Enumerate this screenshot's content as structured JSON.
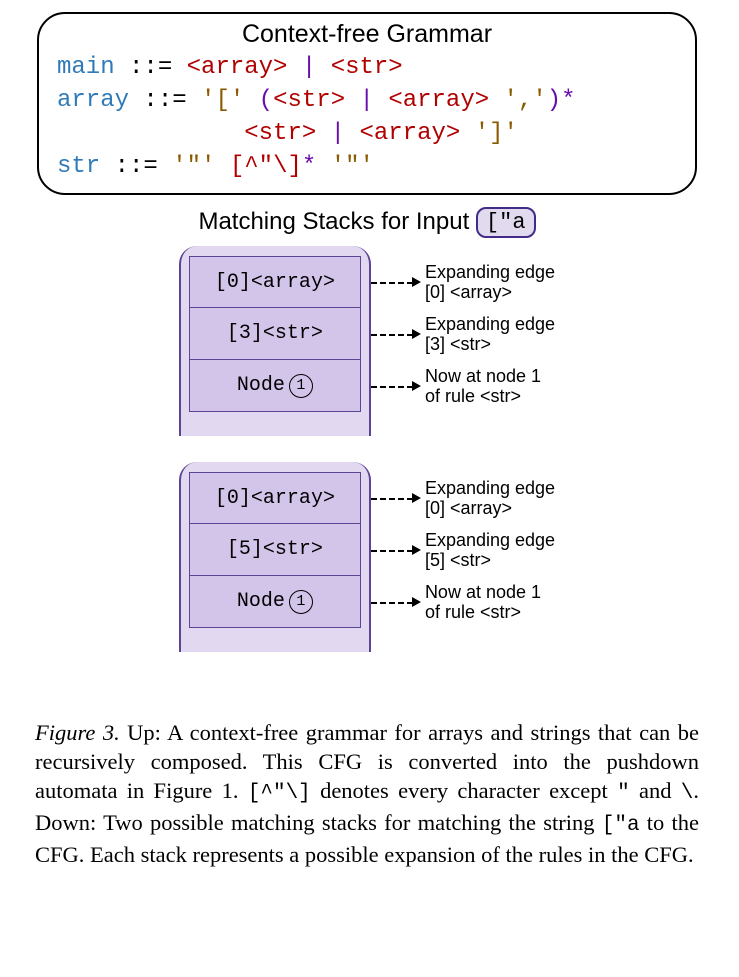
{
  "grammar": {
    "title": "Context-free Grammar",
    "line1": {
      "rule": "main",
      "op": "::=",
      "nt1": "<array>",
      "pipe": "|",
      "nt2": "<str>"
    },
    "line2": {
      "rule": "array",
      "op": "::=",
      "lit1": "'['",
      "lp": "(",
      "nt1": "<str>",
      "pipe": "|",
      "nt2": "<array>",
      "comma": "','",
      "rp": ")",
      "star": "*"
    },
    "line3": {
      "nt1": "<str>",
      "pipe": "|",
      "nt2": "<array>",
      "lit2": "']'"
    },
    "line4": {
      "rule": "str",
      "op": "::=",
      "q1": "'\"'",
      "cc": "[^\"\\]",
      "star": "*",
      "q2": "'\"'"
    }
  },
  "subhead": {
    "prefix": "Matching Stacks for Input",
    "input": "[\"a"
  },
  "stacks": [
    {
      "cells": [
        {
          "plain": "[0]<array>"
        },
        {
          "plain": "[3]<str>"
        },
        {
          "prefix": "Node ",
          "circled": "1"
        }
      ],
      "annots": [
        {
          "l1": "Expanding edge",
          "l2": "[0] <array>"
        },
        {
          "l1": "Expanding edge",
          "l2": "[3] <str>"
        },
        {
          "l1": "Now at node 1",
          "l2": "of rule <str>"
        }
      ]
    },
    {
      "cells": [
        {
          "plain": "[0]<array>"
        },
        {
          "plain": "[5]<str>"
        },
        {
          "prefix": "Node ",
          "circled": "1"
        }
      ],
      "annots": [
        {
          "l1": "Expanding edge",
          "l2": "[0] <array>"
        },
        {
          "l1": "Expanding edge",
          "l2": "[5] <str>"
        },
        {
          "l1": "Now at node 1",
          "l2": "of rule <str>"
        }
      ]
    }
  ],
  "caption": {
    "figLabel": "Figure 3.",
    "t1": " Up: A context-free grammar for arrays and strings that can be recursively composed. This CFG is converted into the pushdown automata in Figure 1. ",
    "cc": "[^\"\\]",
    "t2": " denotes every character except ",
    "q": "\"",
    "t3": " and ",
    "bs": "\\",
    "t4": ". Down: Two possible matching stacks for matching the string ",
    "input": "[\"a",
    "t5": " to the CFG. Each stack represents a possible expansion of the rules in the CFG."
  }
}
